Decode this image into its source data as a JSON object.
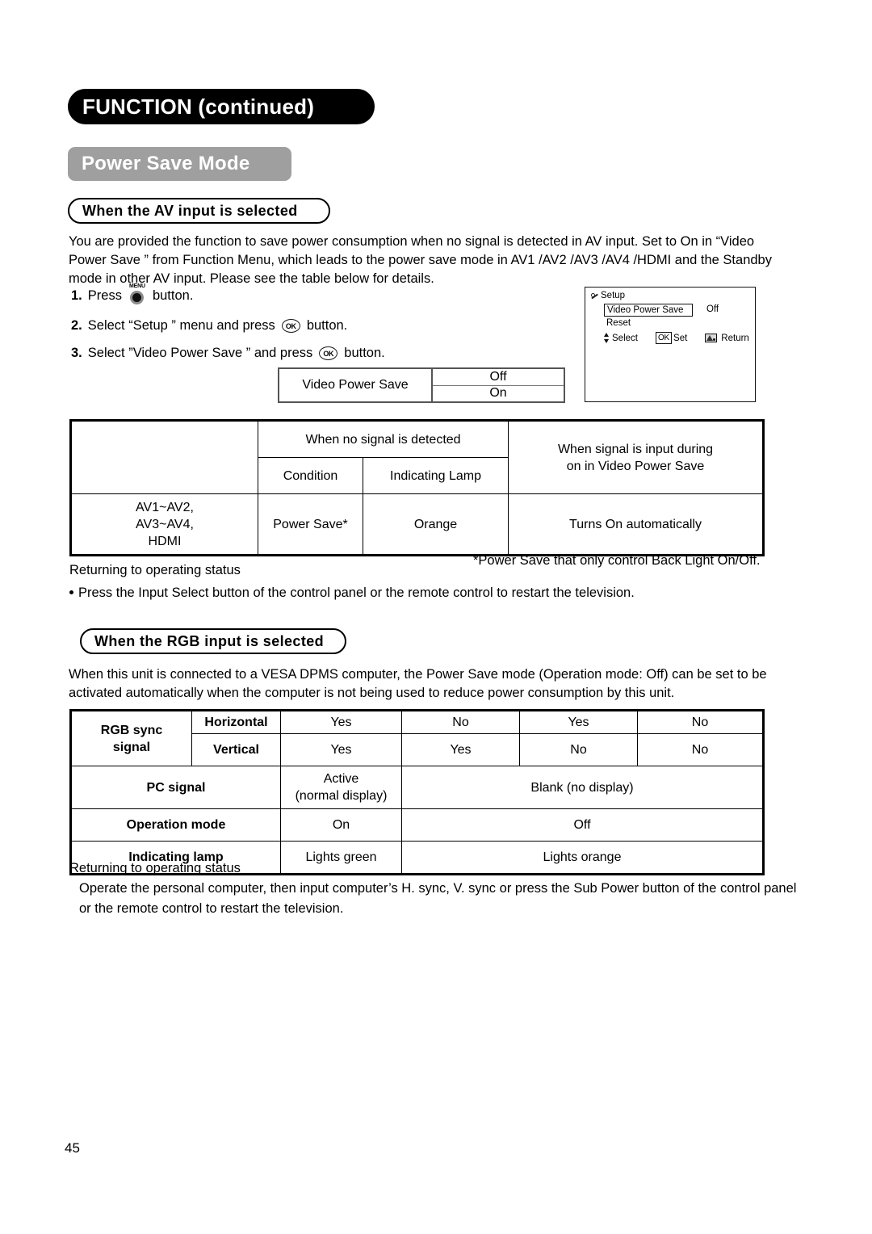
{
  "header": {
    "chapter_title": "FUNCTION (continued)",
    "section_title": "Power Save Mode"
  },
  "av_section": {
    "sub_heading": "When the AV input is selected",
    "intro_paragraph": "You are provided the function to save power consumption when no signal is detected in AV input. Set to On in “Video Power Save ” from Function Menu, which leads to the power save mode in AV1 /AV2 /AV3 /AV4 /HDMI and the Standby mode in other AV input. Please see the table below for details.",
    "steps": [
      {
        "number": "1.",
        "text_before": "Press",
        "icon": "menu-button-icon",
        "icon_label": "MENU",
        "text_after": "button."
      },
      {
        "number": "2.",
        "text_before": "Select “Setup ” menu and press",
        "icon": "ok-button-icon",
        "icon_label": "OK",
        "text_after": "button."
      },
      {
        "number": "3.",
        "text_before": "Select ”Video Power Save ” and press",
        "icon": "ok-button-icon",
        "icon_label": "OK",
        "text_after": "button."
      }
    ],
    "vps_table": {
      "label": "Video Power Save",
      "options": [
        "Off",
        "On"
      ]
    },
    "osd": {
      "title": "Setup",
      "menu_item": "Video Power Save",
      "menu_value": "Off",
      "second_item": "Reset",
      "select_label": "Select",
      "ok_chip": "OK",
      "set_label": "Set",
      "return_label": "Return"
    },
    "table": {
      "group_header_no_signal": "When no signal is detected",
      "header_signal_input_line1": "When signal is input during",
      "header_signal_input_line2": "on in  Video Power Save",
      "sub_header_condition": "Condition",
      "sub_header_lamp": "Indicating Lamp",
      "row_inputs_line1": "AV1~AV2,",
      "row_inputs_line2": "AV3~AV4,",
      "row_inputs_line3": "HDMI",
      "row_condition": "Power Save*",
      "row_lamp": "Orange",
      "row_signal_input": "Turns On automatically"
    },
    "notes": {
      "returning_title": "Returning to operating status",
      "footnote": "*Power Save that only control Back Light On/Off.",
      "bullet": "Press the Input Select  button of the control panel or the remote control to restart the television."
    }
  },
  "rgb_section": {
    "sub_heading": "When the RGB input is selected",
    "paragraph": "When this unit is connected to a VESA DPMS computer, the Power Save mode (Operation mode: Off) can be set to be activated automatically when the computer is not being used to reduce power consumption by this unit.",
    "table": {
      "row_label_sync_line1": "RGB sync",
      "row_label_sync_line2": "signal",
      "label_horizontal": "Horizontal",
      "label_vertical": "Vertical",
      "horizontal_values": [
        "Yes",
        "No",
        "Yes",
        "No"
      ],
      "vertical_values": [
        "Yes",
        "Yes",
        "No",
        "No"
      ],
      "label_pc_signal": "PC signal",
      "pc_signal_active_line1": "Active",
      "pc_signal_active_line2": "(normal display)",
      "pc_signal_blank": "Blank (no display)",
      "label_operation_mode": "Operation mode",
      "operation_mode_on": "On",
      "operation_mode_off": "Off",
      "label_indicating_lamp": "Indicating lamp",
      "lamp_green": "Lights green",
      "lamp_orange": "Lights orange"
    },
    "notes": {
      "returning_title": "Returning to operating status",
      "body": "Operate the personal computer, then input computer’s H. sync, V. sync or press the Sub Power  button of the control panel or the remote control to restart the television."
    }
  },
  "footer": {
    "page_number": "45"
  },
  "colors": {
    "banner_black": "#000000",
    "banner_gray": "#9f9f9f",
    "text": "#000000",
    "table_border": "#000000"
  }
}
